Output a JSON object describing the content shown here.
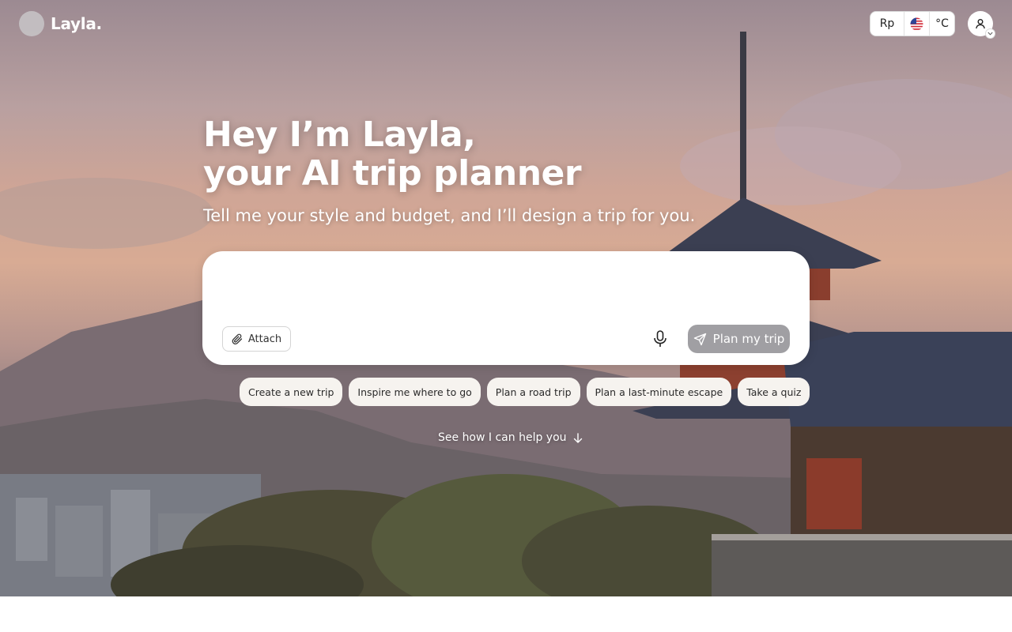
{
  "brand": {
    "name": "Layla."
  },
  "header": {
    "currency": "Rp",
    "flag_icon": "us-flag-icon",
    "temperature_unit": "°C",
    "account_icon": "user-icon"
  },
  "hero": {
    "headline_line1": "Hey I’m Layla,",
    "headline_line2": "your AI trip planner",
    "subheadline": "Tell me your style and budget, and I’ll design a trip for you."
  },
  "prompt_box": {
    "value": "",
    "placeholder": "",
    "attach_label": "Attach",
    "plan_label": "Plan my trip"
  },
  "suggestions": [
    {
      "label": "Create a new trip"
    },
    {
      "label": "Inspire me where to go"
    },
    {
      "label": "Plan a road trip"
    },
    {
      "label": "Plan a last-minute escape"
    },
    {
      "label": "Take a quiz"
    }
  ],
  "see_how": {
    "label": "See how I can help you"
  },
  "colors": {
    "primary_button_disabled": "#a09fa3",
    "chip_background": "#f6f3ef"
  }
}
